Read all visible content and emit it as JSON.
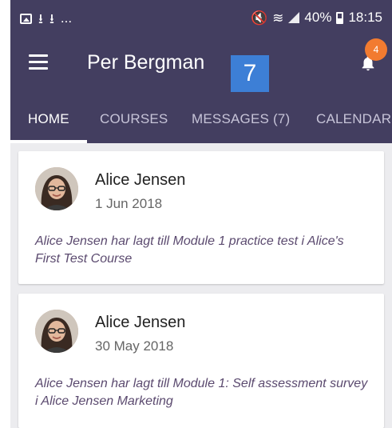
{
  "status_bar": {
    "left_icons": [
      "image-icon",
      "download-icon",
      "download-icon"
    ],
    "ellipsis": "...",
    "battery": "40%",
    "time": "18:15"
  },
  "app_bar": {
    "title": "Per Bergman",
    "counter": "7",
    "notification_count": "4"
  },
  "tabs": [
    {
      "label": "HOME",
      "active": true
    },
    {
      "label": "COURSES",
      "active": false
    },
    {
      "label": "MESSAGES (7)",
      "active": false
    },
    {
      "label": "CALENDAR",
      "active": false
    }
  ],
  "feed": [
    {
      "name": "Alice Jensen",
      "date": "1 Jun 2018",
      "text": "Alice Jensen har lagt till Module 1 practice test i Alice's First Test Course"
    },
    {
      "name": "Alice Jensen",
      "date": "30 May 2018",
      "text": "Alice Jensen har lagt till Module 1: Self assessment survey i Alice Jensen Marketing"
    }
  ],
  "colors": {
    "header": "#433e60",
    "counter_box": "#3d7fd6",
    "badge": "#f27b30",
    "activity_text": "#5b4a6f"
  }
}
